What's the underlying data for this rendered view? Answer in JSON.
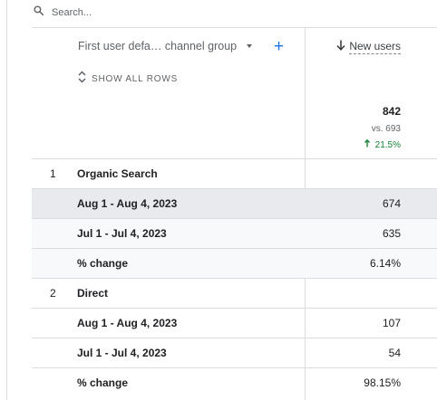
{
  "search": {
    "placeholder": "Search..."
  },
  "dimension": {
    "label": "First user defa… channel group",
    "show_rows_label": "SHOW ALL ROWS"
  },
  "metric": {
    "label": "New users",
    "total": "842",
    "compare": "vs. 693",
    "change": "21.5%"
  },
  "rows": [
    {
      "index": "1",
      "label": "Organic Search",
      "value": ""
    },
    {
      "index": "",
      "label": "Aug 1 - Aug 4, 2023",
      "value": "674"
    },
    {
      "index": "",
      "label": "Jul 1 - Jul 4, 2023",
      "value": "635"
    },
    {
      "index": "",
      "label": "% change",
      "value": "6.14%"
    },
    {
      "index": "2",
      "label": "Direct",
      "value": ""
    },
    {
      "index": "",
      "label": "Aug 1 - Aug 4, 2023",
      "value": "107"
    },
    {
      "index": "",
      "label": "Jul 1 - Jul 4, 2023",
      "value": "54"
    },
    {
      "index": "",
      "label": "% change",
      "value": "98.15%"
    }
  ]
}
